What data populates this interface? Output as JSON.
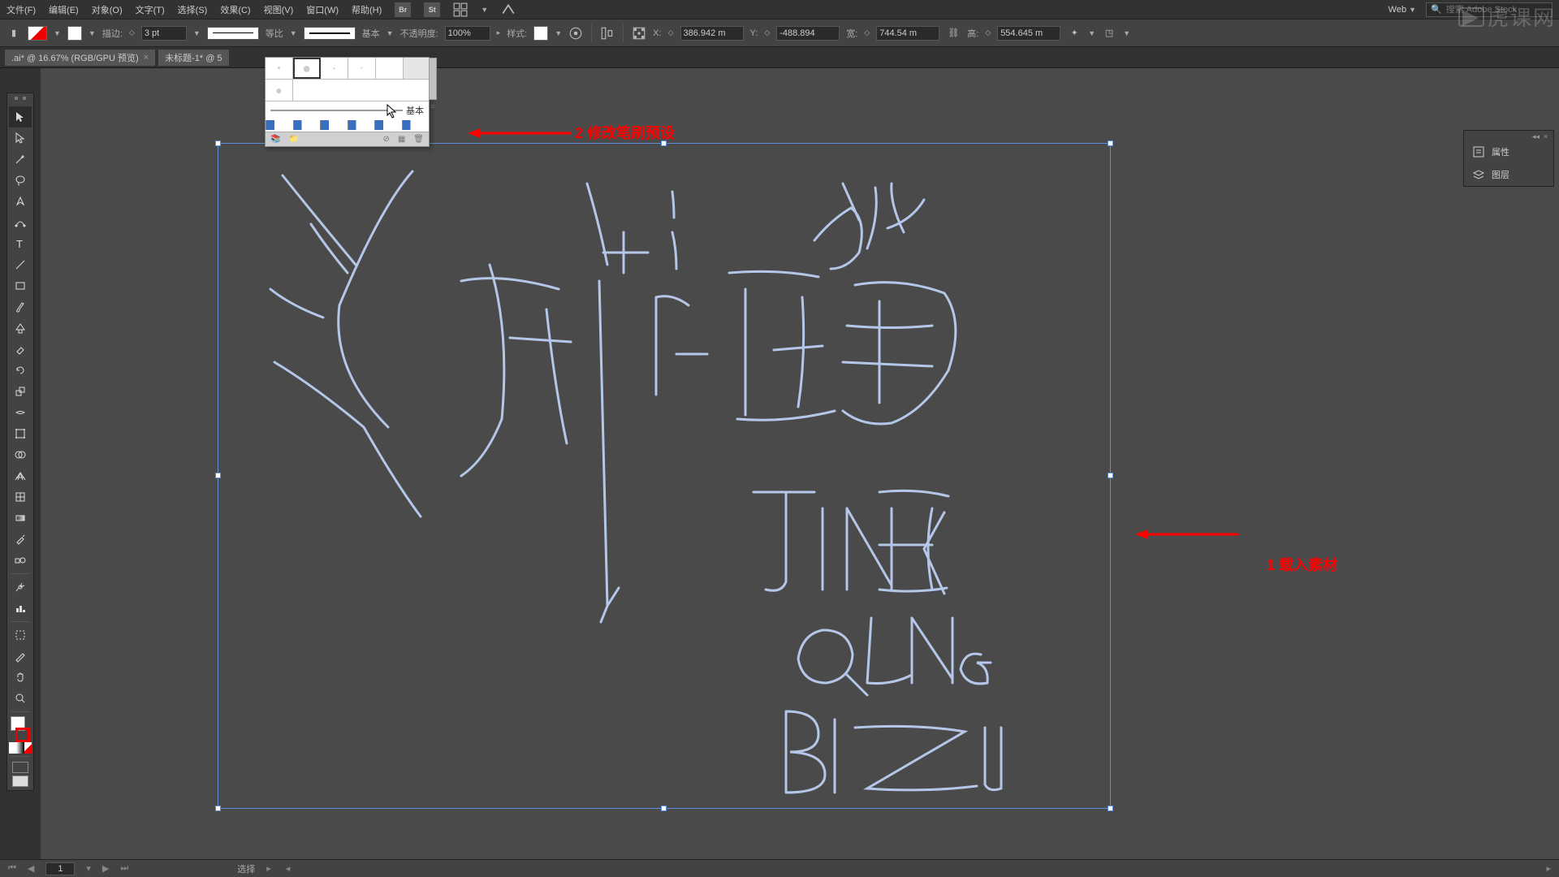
{
  "menu": {
    "file": "文件(F)",
    "edit": "编辑(E)",
    "object": "对象(O)",
    "text": "文字(T)",
    "select": "选择(S)",
    "effect": "效果(C)",
    "view": "视图(V)",
    "window": "窗口(W)",
    "help": "帮助(H)",
    "workspace": "Web"
  },
  "search": {
    "placeholder": "搜索 Adobe Stock"
  },
  "control": {
    "stroke_label": "描边:",
    "stroke_weight": "3 pt",
    "profile_label": "等比",
    "brush_label": "基本",
    "opacity_label": "不透明度:",
    "opacity_value": "100%",
    "style_label": "样式:",
    "x_label": "X:",
    "x_value": "386.942 m",
    "y_label": "Y:",
    "y_value": "-488.894",
    "w_label": "宽:",
    "w_value": "744.54 m",
    "h_label": "高:",
    "h_value": "554.645 m"
  },
  "tabs": {
    "0": {
      "label": ".ai* @ 16.67% (RGB/GPU 预览)"
    },
    "1": {
      "label": "未标题-1* @ 5"
    }
  },
  "brushpanel": {
    "label": "基本"
  },
  "rightpanel": {
    "properties": "属性",
    "layers": "图层"
  },
  "annotations": {
    "0": "2 修改笔刷预设",
    "1": "1 载入素材"
  },
  "statusbar": {
    "page": "1",
    "mode": "选择"
  },
  "watermark": "虎课网"
}
